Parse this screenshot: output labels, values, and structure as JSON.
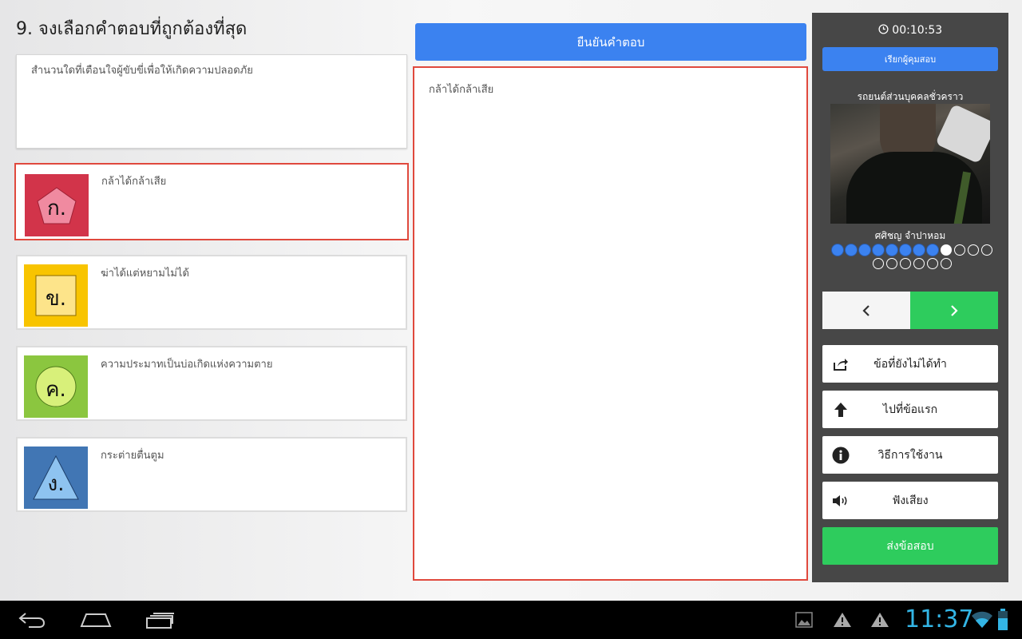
{
  "question": {
    "title": "9. จงเลือกคำตอบที่ถูกต้องที่สุด",
    "text": "สำนวนใดที่เตือนใจผู้ขับขี่เพื่อให้เกิดความปลอดภัย"
  },
  "choices": [
    {
      "letter": "ก.",
      "text": "กล้าได้กล้าเสีย",
      "color": "#d2344a",
      "shape": "pentagon",
      "shape_color": "#f08aa0",
      "selected": true
    },
    {
      "letter": "ข.",
      "text": "ฆ่าได้แต่หยามไม่ได้",
      "color": "#f8c400",
      "shape": "square",
      "shape_color": "#fde48a",
      "selected": false
    },
    {
      "letter": "ค.",
      "text": "ความประมาทเป็นบ่อเกิดแห่งความตาย",
      "color": "#8bc63f",
      "shape": "circle",
      "shape_color": "#d8f07a",
      "selected": false
    },
    {
      "letter": "ง.",
      "text": "กระต่ายตื่นตูม",
      "color": "#4176b4",
      "shape": "triangle",
      "shape_color": "#8ec3f0",
      "selected": false
    }
  ],
  "confirm_button": "ยืนยันคำตอบ",
  "answer_preview": "กล้าได้กล้าเสีย",
  "panel": {
    "timer": "00:10:53",
    "call_proctor": "เรียกผู้คุมสอบ",
    "license_type": "รถยนต์ส่วนบุคคลชั่วคราว",
    "examinee_name": "ศศิชญ จำปาหอม",
    "progress": {
      "total": 18,
      "answered": 8,
      "current": 9
    },
    "prev_label": "‹",
    "next_label": "›",
    "buttons": {
      "unanswered": "ข้อที่ยังไม่ได้ทำ",
      "first": "ไปที่ข้อแรก",
      "howto": "วิธีการใช้งาน",
      "listen": "ฟังเสียง"
    },
    "submit": "ส่งข้อสอบ"
  },
  "system_bar": {
    "clock": "11:37"
  },
  "colors": {
    "primary_blue": "#3b82f0",
    "green": "#2ecc5d",
    "selected_border": "#e0493d",
    "panel_bg": "#474747",
    "clock_blue": "#33b5e5"
  }
}
